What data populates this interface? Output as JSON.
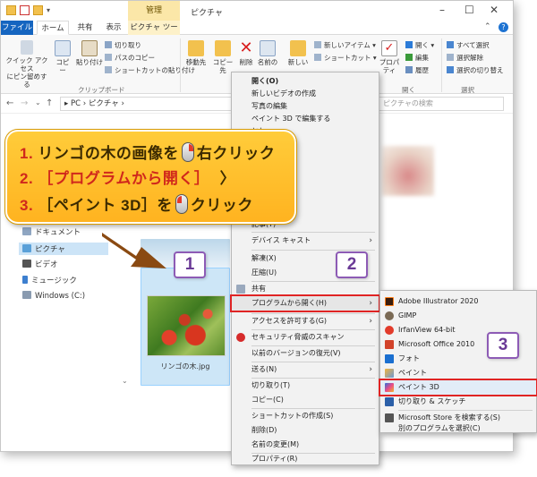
{
  "window": {
    "title": "ピクチャ",
    "context_tab_header": "管理"
  },
  "tabs": {
    "file": "ファイル",
    "home": "ホーム",
    "share": "共有",
    "view": "表示",
    "picture_tools": "ピクチャ ツール"
  },
  "ribbon": {
    "quick_access": "クイック アクセス\nにピン留めする",
    "copy": "コピー",
    "paste": "貼り付け",
    "cut": "切り取り",
    "copy_path": "パスのコピー",
    "paste_shortcut": "ショートカットの貼り付け",
    "clipboard_group": "クリップボード",
    "move_to": "移動先",
    "copy_to": "コピー先",
    "delete": "削除",
    "rename": "名前の",
    "new_folder": "新しい",
    "new_item": "新しいアイテム ▾",
    "shortcut": "ショートカット ▾",
    "properties": "プロパティ",
    "open": "開く ▾",
    "edit": "編集",
    "history": "履歴",
    "open_group": "開く",
    "select_all": "すべて選択",
    "select_none": "選択解除",
    "invert": "選択の切り替え",
    "select_group": "選択"
  },
  "address": {
    "path": "▸ PC › ピクチャ ›",
    "search_placeholder": "ピクチャの検索"
  },
  "nav": {
    "items": [
      "ドキュメント",
      "ピクチャ",
      "ビデオ",
      "ミュージック",
      "Windows (C:)"
    ]
  },
  "content": {
    "file_caption": "リンゴの木.jpg"
  },
  "callout": {
    "line1_num": "1.",
    "line1_text": "リンゴの木の画像を",
    "line1_action": "右クリック",
    "line2_num": "2.",
    "line2_text": "［プログラムから開く］",
    "line2_arrow": "〉",
    "line3_num": "3.",
    "line3_text": "［ペイント 3D］を",
    "line3_action": "クリック"
  },
  "steps": {
    "s1": "1",
    "s2": "2",
    "s3": "3"
  },
  "context_menu": {
    "open": "開く(O)",
    "new_video": "新しいビデオの作成",
    "edit_photo": "写真の編集",
    "edit_paint3d": "ペイント 3D で編集する",
    "partial1": "とし",
    "partial2": "として設定(B)",
    "partial3": "を右に回転",
    "partial4": "を左に回転",
    "partial5": "記事(T)",
    "device_cast": "デバイス キャスト",
    "extract": "解凍(X)",
    "compress": "圧縮(U)",
    "share": "共有",
    "open_with": "プログラムから開く(H)",
    "give_access": "アクセスを許可する(G)",
    "security_scan": "セキュリティ脅威のスキャン",
    "restore": "以前のバージョンの復元(V)",
    "send_to": "送る(N)",
    "cut": "切り取り(T)",
    "copy": "コピー(C)",
    "create_shortcut": "ショートカットの作成(S)",
    "delete": "削除(D)",
    "rename": "名前の変更(M)",
    "properties": "プロパティ(R)"
  },
  "submenu": {
    "items": [
      "Adobe Illustrator 2020",
      "GIMP",
      "IrfanView 64-bit",
      "Microsoft Office 2010",
      "フォト",
      "ペイント",
      "ペイント 3D",
      "切り取り & スケッチ"
    ],
    "store": "Microsoft Store を検索する(S)",
    "other": "別のプログラムを選択(C)"
  },
  "colors": {
    "accent": "#1565c0",
    "callout": "#ffbf2a",
    "highlight": "#e02424",
    "step_border": "#8d5bb5"
  }
}
